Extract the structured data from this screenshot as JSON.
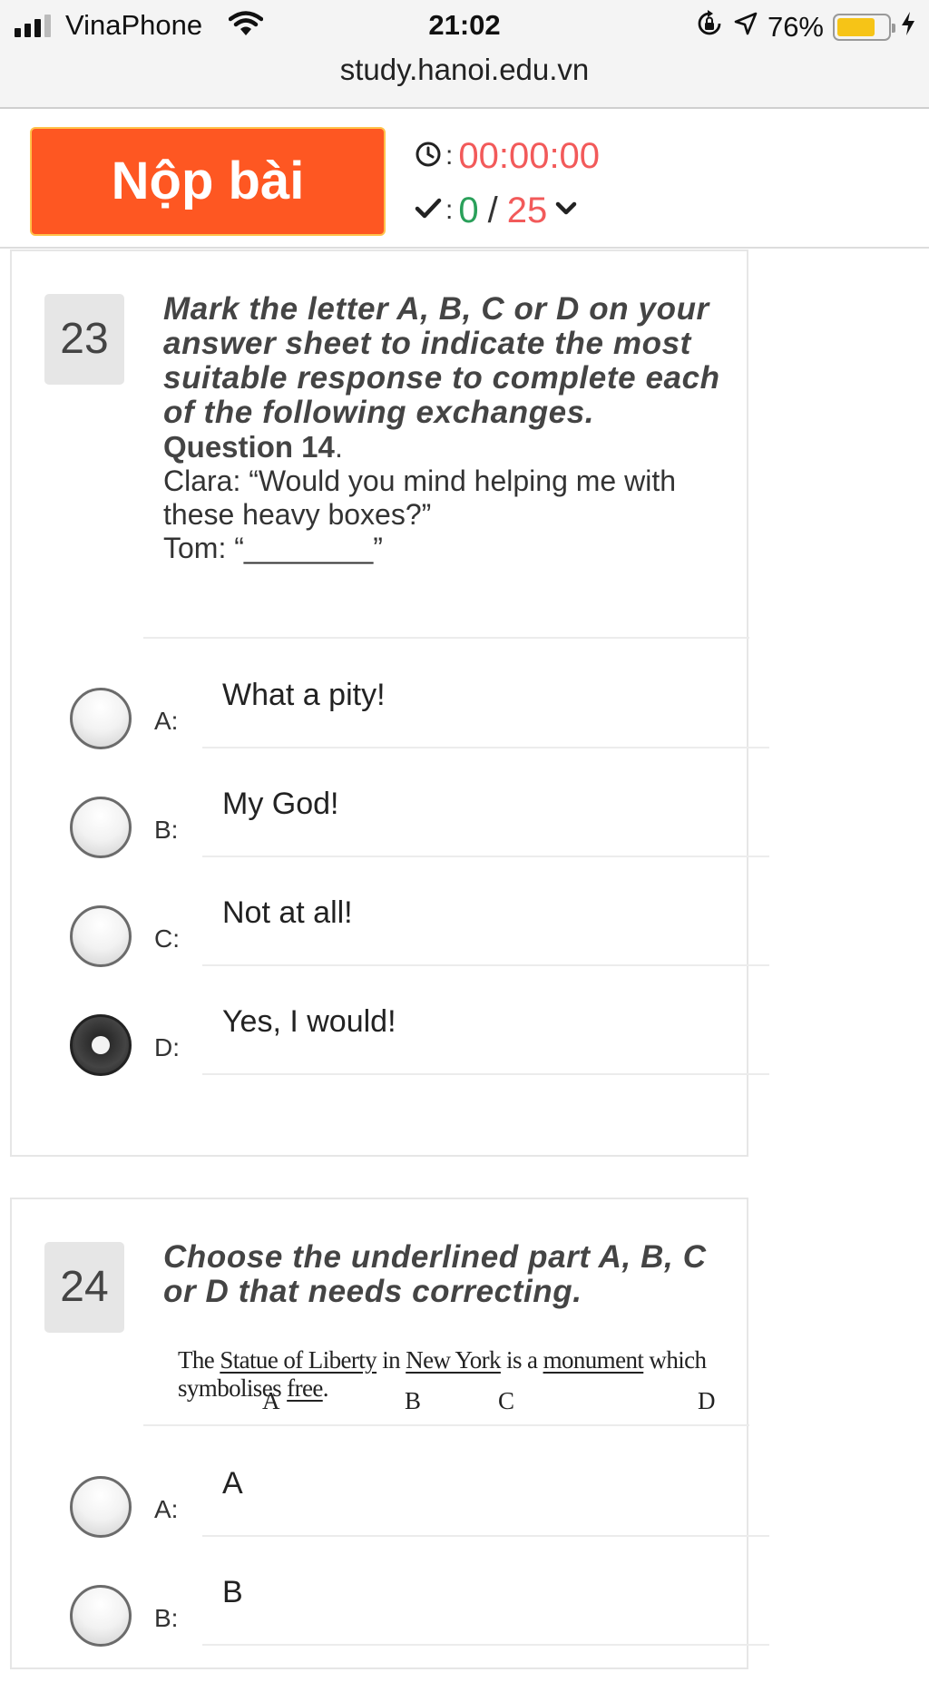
{
  "status_bar": {
    "carrier": "VinaPhone",
    "time": "21:02",
    "battery": "76%",
    "battery_level": 0.76,
    "url": "study.hanoi.edu.vn"
  },
  "header": {
    "submit_label": "Nộp bài",
    "timer": "00:00:00",
    "colon": ":",
    "answered": "0",
    "slash": "/",
    "total": "25",
    "colors": {
      "submit": "#fe5722",
      "timer": "#f25a5a",
      "answered": "#2aa05a"
    }
  },
  "questions": [
    {
      "number": "23",
      "instruction": "Mark the letter A, B, C or D on your answer sheet to indicate the most suitable response to complete each of the following exchanges.",
      "label": "Question 14",
      "label_suffix": ".",
      "text_line1": "Clara: “Would you mind helping me with these heavy boxes?”",
      "text_line2": "Tom: “________”",
      "options": [
        {
          "letter": "A:",
          "text": "What a pity!",
          "selected": false
        },
        {
          "letter": "B:",
          "text": "My God!",
          "selected": false
        },
        {
          "letter": "C:",
          "text": "Not at all!",
          "selected": false
        },
        {
          "letter": "D:",
          "text": "Yes, I would!",
          "selected": true
        }
      ]
    },
    {
      "number": "24",
      "instruction": "Choose the underlined part A, B, C or D that needs correcting.",
      "sentence": {
        "p1": "The ",
        "u1": "Statue of Liberty",
        "p2": " in ",
        "u2": "New York",
        "p3": " is a ",
        "u3": "monument",
        "p4": " which symbolises ",
        "u4": "free",
        "p5": ".",
        "letters": [
          "A",
          "B",
          "C",
          "D"
        ]
      },
      "options": [
        {
          "letter": "A:",
          "text": "A",
          "selected": false
        },
        {
          "letter": "B:",
          "text": "B",
          "selected": false
        }
      ]
    }
  ]
}
